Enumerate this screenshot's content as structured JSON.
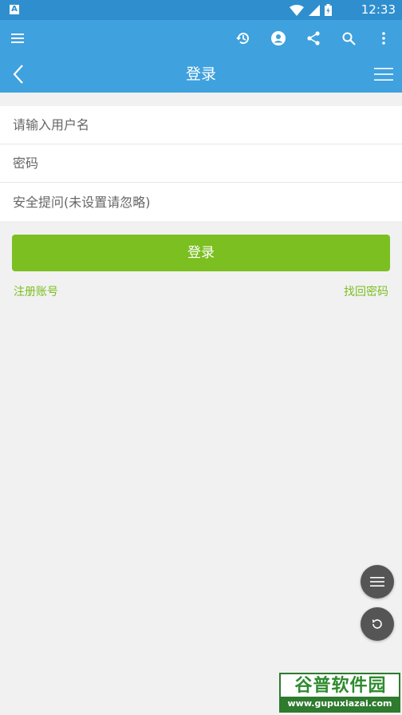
{
  "status_bar": {
    "notification_badge": "A",
    "time": "12:33",
    "icons": [
      "wifi-icon",
      "signal-icon",
      "battery-icon"
    ]
  },
  "toolbar": {
    "icons": [
      "hamburger-menu-icon",
      "history-icon",
      "account-icon",
      "share-icon",
      "search-icon",
      "more-vert-icon"
    ]
  },
  "title_bar": {
    "title": "登录"
  },
  "form": {
    "username_placeholder": "请输入用户名",
    "password_placeholder": "密码",
    "security_placeholder": "安全提问(未设置请忽略)"
  },
  "login_button_label": "登录",
  "links": {
    "register": "注册账号",
    "recover_password": "找回密码"
  },
  "watermark": {
    "brand": "谷普软件园",
    "url": "www.gupuxiazai.com"
  },
  "colors": {
    "status_bar": "#2f8fce",
    "toolbar": "#3fa1de",
    "accent": "#7bbf20",
    "background": "#f1f1f1"
  }
}
